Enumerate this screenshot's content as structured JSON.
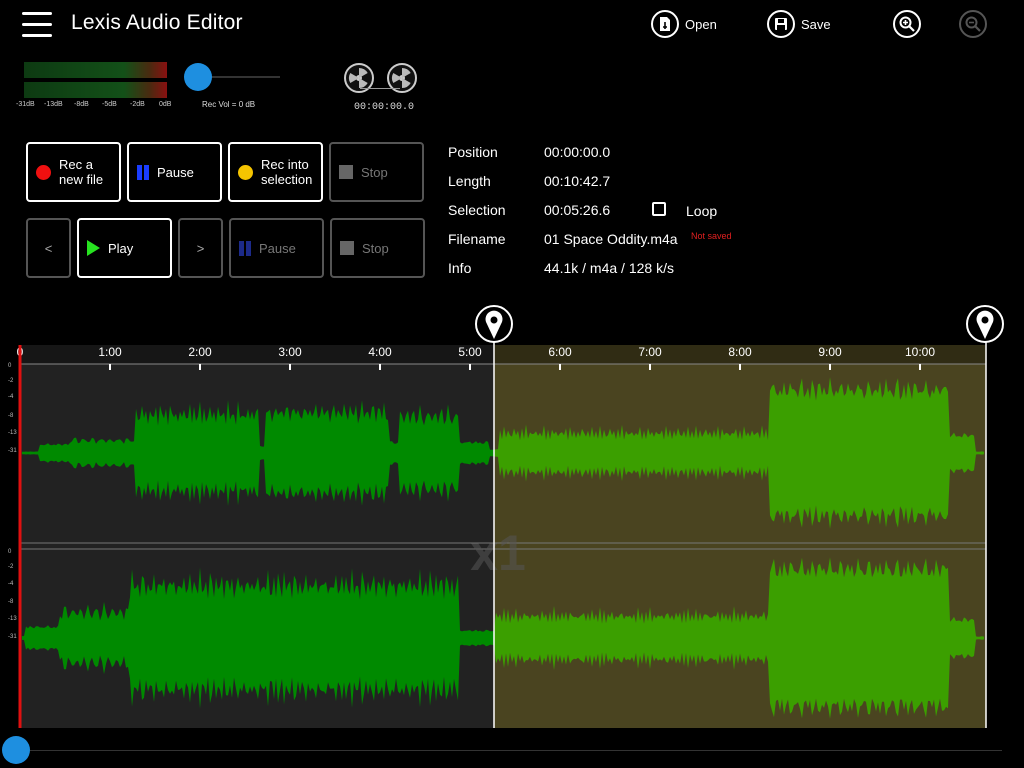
{
  "app": {
    "title": "Lexis Audio Editor"
  },
  "toolbar": {
    "menu_icon": "hamburger-menu-icon",
    "open_label": "Open",
    "save_label": "Save",
    "zoom_in_icon": "zoom-in-icon",
    "zoom_out_icon": "zoom-out-icon"
  },
  "meter": {
    "scale": [
      "-31dB",
      "-13dB",
      "-8dB",
      "-5dB",
      "-2dB",
      "0dB"
    ],
    "rec_vol_label": "Rec Vol = 0 dB",
    "timer": "00:00:00.0"
  },
  "transport": {
    "rec_new_file": "Rec a\nnew file",
    "pause": "Pause",
    "rec_into_selection": "Rec into\nselection",
    "stop": "Stop",
    "prev": "<",
    "play": "Play",
    "next": ">",
    "pause2": "Pause",
    "stop2": "Stop"
  },
  "info": {
    "position_label": "Position",
    "position_value": "00:00:00.0",
    "length_label": "Length",
    "length_value": "00:10:42.7",
    "selection_label": "Selection",
    "selection_value": "00:05:26.6",
    "loop_label": "Loop",
    "loop_checked": false,
    "filename_label": "Filename",
    "filename_value": "01 Space Oddity.m4a",
    "not_saved": "Not saved",
    "info_label": "Info",
    "info_value": "44.1k / m4a / 128 k/s"
  },
  "waveform": {
    "timeline": [
      "0",
      "1:00",
      "2:00",
      "3:00",
      "4:00",
      "5:00",
      "6:00",
      "7:00",
      "8:00",
      "9:00",
      "10:00"
    ],
    "zoom_label": "x1",
    "db_scale": [
      "0",
      "-2",
      "-4",
      "-8",
      "-13",
      "-31"
    ],
    "colors": {
      "unselected": "#008a00",
      "selected": "#3b9f00",
      "selection_bg": "#4a4420",
      "base_bg": "#222222",
      "cursor": "#e01010"
    }
  }
}
